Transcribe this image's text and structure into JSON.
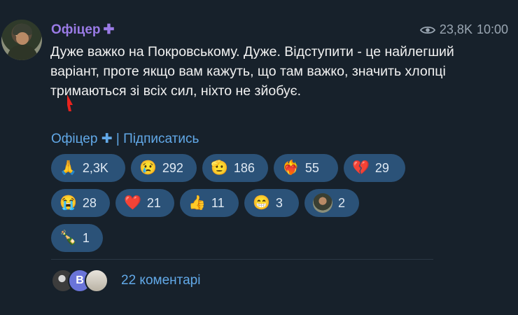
{
  "post": {
    "author": "Офіцер",
    "author_badge": "✚",
    "views": "23,8K",
    "time": "10:00",
    "text": "Дуже важко на Покровському. Дуже. Відступити - це найлегший варіант, проте якщо вам кажуть, що там важко, значить хлопці тримаються зі всіх сил, ніхто не зйобує.",
    "channel_link": "Офіцер ✚ | Підписатись"
  },
  "reactions": [
    {
      "emoji": "🙏",
      "count": "2,3K"
    },
    {
      "emoji": "😢",
      "count": "292"
    },
    {
      "emoji": "🫡",
      "count": "186"
    },
    {
      "emoji": "❤️‍🔥",
      "count": "55"
    },
    {
      "emoji": "💔",
      "count": "29"
    },
    {
      "emoji": "😭",
      "count": "28"
    },
    {
      "emoji": "❤️",
      "count": "21"
    },
    {
      "emoji": "👍",
      "count": "11"
    },
    {
      "emoji": "😁",
      "count": "3"
    },
    {
      "emoji": "avatar",
      "count": "2"
    },
    {
      "emoji": "🍾",
      "count": "1"
    }
  ],
  "comments": {
    "avatar_letter": "B",
    "label": "22 коментарі"
  },
  "colors": {
    "background": "#17212b",
    "author": "#9a7be6",
    "link": "#62a9e8",
    "reaction_bg": "#2b5278"
  }
}
